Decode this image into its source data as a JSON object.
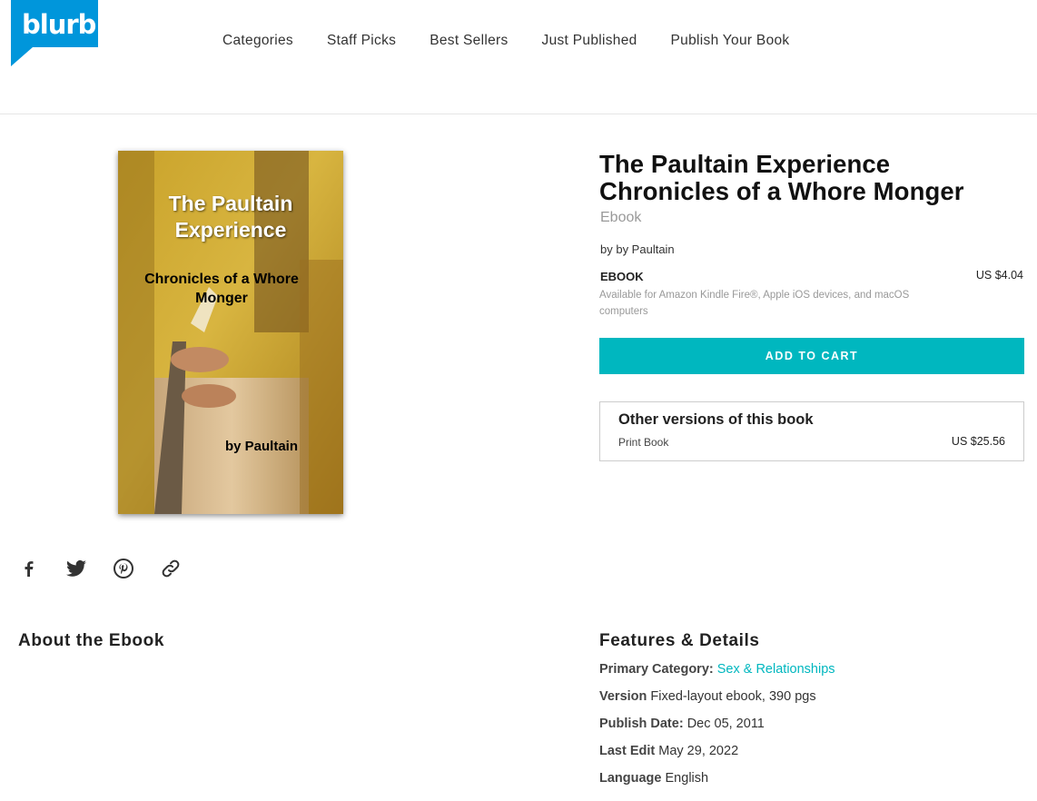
{
  "brand": {
    "logo_text": "blurb",
    "color": "#0096db"
  },
  "nav": [
    "Categories",
    "Staff Picks",
    "Best Sellers",
    "Just Published",
    "Publish Your Book"
  ],
  "cover": {
    "title": "The Paultain Experience",
    "subtitle": "Chronicles of a Whore Monger",
    "author": "by Paultain"
  },
  "share": {
    "icons": [
      "facebook-icon",
      "twitter-icon",
      "pinterest-icon",
      "link-icon"
    ]
  },
  "product": {
    "title": "The Paultain Experience Chronicles of a Whore Monger",
    "format": "Ebook",
    "author": "by by Paultain",
    "ebook_label": "EBOOK",
    "availability": "Available for Amazon Kindle Fire®, Apple iOS devices, and macOS computers",
    "price": "US $4.04",
    "add_to_cart": "ADD TO CART",
    "accent": "#00b7bf"
  },
  "other_versions": {
    "title": "Other versions of this book",
    "items": [
      {
        "name": "Print Book",
        "price": "US $25.56"
      }
    ]
  },
  "about": {
    "heading": "About the Ebook"
  },
  "features": {
    "heading": "Features & Details",
    "rows": [
      {
        "label": "Primary Category:",
        "value": "Sex & Relationships"
      },
      {
        "label": "Version",
        "value": "Fixed-layout ebook, 390 pgs"
      },
      {
        "label": "Publish Date:",
        "value": "Dec 05, 2011"
      },
      {
        "label": "Last Edit",
        "value": "May 29, 2022"
      },
      {
        "label": "Language",
        "value": "English"
      }
    ]
  }
}
